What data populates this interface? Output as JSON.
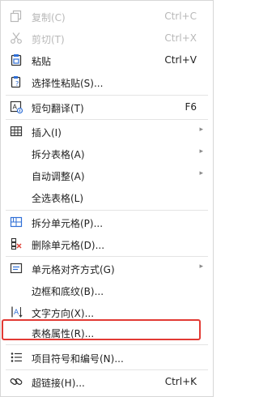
{
  "menu": {
    "items": [
      {
        "label": "复制(C)",
        "shortcut": "Ctrl+C",
        "icon": "copy-icon",
        "disabled": true
      },
      {
        "label": "剪切(T)",
        "shortcut": "Ctrl+X",
        "icon": "scissors-icon",
        "disabled": true
      },
      {
        "label": "粘贴",
        "shortcut": "Ctrl+V",
        "icon": "paste-icon",
        "disabled": false
      },
      {
        "label": "选择性粘贴(S)...",
        "shortcut": "",
        "icon": "paste-special-icon",
        "disabled": false
      },
      {
        "label": "短句翻译(T)",
        "shortcut": "F6",
        "icon": "translate-icon",
        "disabled": false
      },
      {
        "label": "插入(I)",
        "shortcut": "",
        "icon": "table-icon",
        "disabled": false,
        "submenu": true
      },
      {
        "label": "拆分表格(A)",
        "shortcut": "",
        "icon": "",
        "disabled": false,
        "submenu": true
      },
      {
        "label": "自动调整(A)",
        "shortcut": "",
        "icon": "",
        "disabled": false,
        "submenu": true
      },
      {
        "label": "全选表格(L)",
        "shortcut": "",
        "icon": "",
        "disabled": false
      },
      {
        "label": "拆分单元格(P)...",
        "shortcut": "",
        "icon": "split-cells-icon",
        "disabled": false
      },
      {
        "label": "删除单元格(D)...",
        "shortcut": "",
        "icon": "delete-cells-icon",
        "disabled": false
      },
      {
        "label": "单元格对齐方式(G)",
        "shortcut": "",
        "icon": "cell-align-icon",
        "disabled": false,
        "submenu": true
      },
      {
        "label": "边框和底纹(B)...",
        "shortcut": "",
        "icon": "",
        "disabled": false
      },
      {
        "label": "文字方向(X)...",
        "shortcut": "",
        "icon": "text-direction-icon",
        "disabled": false
      },
      {
        "label": "表格属性(R)...",
        "shortcut": "",
        "icon": "",
        "disabled": false
      },
      {
        "label": "项目符号和编号(N)...",
        "shortcut": "",
        "icon": "bullets-icon",
        "disabled": false
      },
      {
        "label": "超链接(H)...",
        "shortcut": "Ctrl+K",
        "icon": "link-icon",
        "disabled": false
      }
    ],
    "submenu_arrow": "▸"
  },
  "colors": {
    "highlight_border": "#e23a34",
    "disabled_text": "#b8b8b8",
    "icon_blue": "#2f6fd6",
    "icon_red": "#e0453a"
  }
}
